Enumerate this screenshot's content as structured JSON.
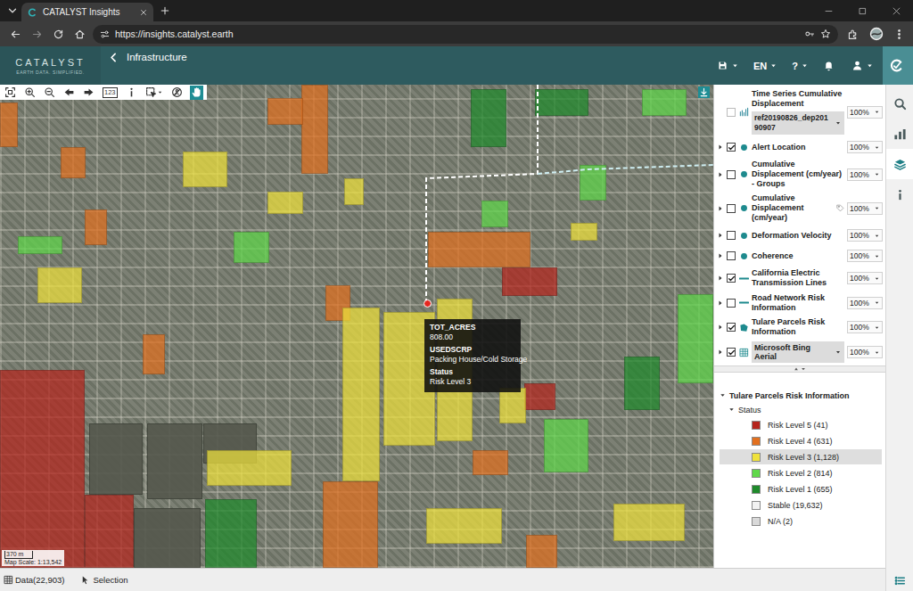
{
  "browser": {
    "tabs": [
      {
        "title": "CATALYST Insights",
        "selected": true
      }
    ],
    "url": "https://insights.catalyst.earth"
  },
  "app": {
    "logo": "CATALYST",
    "tagline": "EARTH DATA. SIMPLIFIED.",
    "section": "Infrastructure",
    "header_items": [
      {
        "kind": "save",
        "menu": true,
        "selected": false
      },
      {
        "kind": "language",
        "label": "EN",
        "menu": true,
        "selected": false
      },
      {
        "kind": "help",
        "label": "?",
        "menu": true,
        "selected": false
      },
      {
        "kind": "notifications",
        "menu": false,
        "selected": false
      },
      {
        "kind": "user",
        "menu": true,
        "selected": false
      },
      {
        "kind": "insights",
        "menu": false,
        "selected": true
      }
    ]
  },
  "map": {
    "tools": [
      {
        "kind": "extent",
        "selected": false
      },
      {
        "kind": "zoomin",
        "selected": false
      },
      {
        "kind": "zoomout",
        "selected": false
      },
      {
        "kind": "back",
        "selected": false
      },
      {
        "kind": "forward",
        "selected": false
      },
      {
        "kind": "measure",
        "label": "123",
        "selected": false
      },
      {
        "kind": "info",
        "selected": false
      },
      {
        "kind": "select",
        "selected": false
      },
      {
        "kind": "clear",
        "selected": false
      },
      {
        "kind": "pan",
        "selected": true
      }
    ],
    "tooltip": {
      "rows": [
        {
          "key": "TOT_ACRES",
          "value": "808.00"
        },
        {
          "key": "USEDSCRP",
          "value": "Packing House/Cold Storage"
        },
        {
          "key": "Status",
          "value": "Risk Level 3"
        }
      ]
    },
    "scale": {
      "distance": "370 m",
      "ratio": "Map Scale: 1:13,542"
    }
  },
  "layers": [
    {
      "name": "Time Series Cumulative Displacement",
      "kind": "series",
      "checked": false,
      "enabled": false,
      "expandable": false,
      "select": "ref20190826_dep20190907",
      "opacity": "100%"
    },
    {
      "name": "Alert Location",
      "kind": "dot",
      "checked": true,
      "enabled": true,
      "expandable": true,
      "opacity": "100%"
    },
    {
      "name": "Cumulative Displacement (cm/year) - Groups",
      "kind": "dot",
      "checked": false,
      "enabled": true,
      "expandable": true,
      "opacity": "100%"
    },
    {
      "name": "Cumulative Displacement (cm/year)",
      "kind": "tagged",
      "checked": false,
      "enabled": true,
      "expandable": true,
      "opacity": "100%"
    },
    {
      "name": "Deformation Velocity",
      "kind": "dot",
      "checked": false,
      "enabled": true,
      "expandable": true,
      "opacity": "100%"
    },
    {
      "name": "Coherence",
      "kind": "dot",
      "checked": false,
      "enabled": true,
      "expandable": true,
      "opacity": "100%"
    },
    {
      "name": "California Electric Transmission Lines",
      "kind": "line",
      "checked": true,
      "enabled": true,
      "expandable": true,
      "opacity": "100%"
    },
    {
      "name": "Road Network Risk Information",
      "kind": "line",
      "checked": false,
      "enabled": true,
      "expandable": true,
      "opacity": "100%"
    },
    {
      "name": "Tulare Parcels Risk Information",
      "kind": "polygon",
      "checked": true,
      "enabled": true,
      "expandable": true,
      "opacity": "100%"
    },
    {
      "name": "Microsoft Bing Aerial",
      "kind": "tiles",
      "checked": true,
      "enabled": true,
      "expandable": true,
      "opacity": "100%"
    }
  ],
  "legend": {
    "title": "Tulare Parcels Risk Information",
    "expanded": true,
    "group": {
      "label": "Status",
      "expanded": true
    },
    "items": [
      {
        "label": "Risk Level 5 (41)",
        "color": "#b5251d",
        "selected": false
      },
      {
        "label": "Risk Level 4 (631)",
        "color": "#e2701f",
        "selected": false
      },
      {
        "label": "Risk Level 3 (1,128)",
        "color": "#efe23c",
        "selected": true
      },
      {
        "label": "Risk Level 2 (814)",
        "color": "#5fd84a",
        "selected": false
      },
      {
        "label": "Risk Level 1 (655)",
        "color": "#1f8a2b",
        "selected": false
      },
      {
        "label": "Stable (19,632)",
        "color": "#f2f2f2",
        "selected": false
      },
      {
        "label": "N/A (2)",
        "color": "#d9d9d9",
        "selected": false
      }
    ]
  },
  "side_tabs": [
    {
      "kind": "search",
      "selected": false
    },
    {
      "kind": "chart",
      "selected": false
    },
    {
      "kind": "layers",
      "selected": true
    },
    {
      "kind": "info",
      "selected": false
    }
  ],
  "status_bar": {
    "data": "Data(22,903)",
    "selection": "Selection"
  }
}
